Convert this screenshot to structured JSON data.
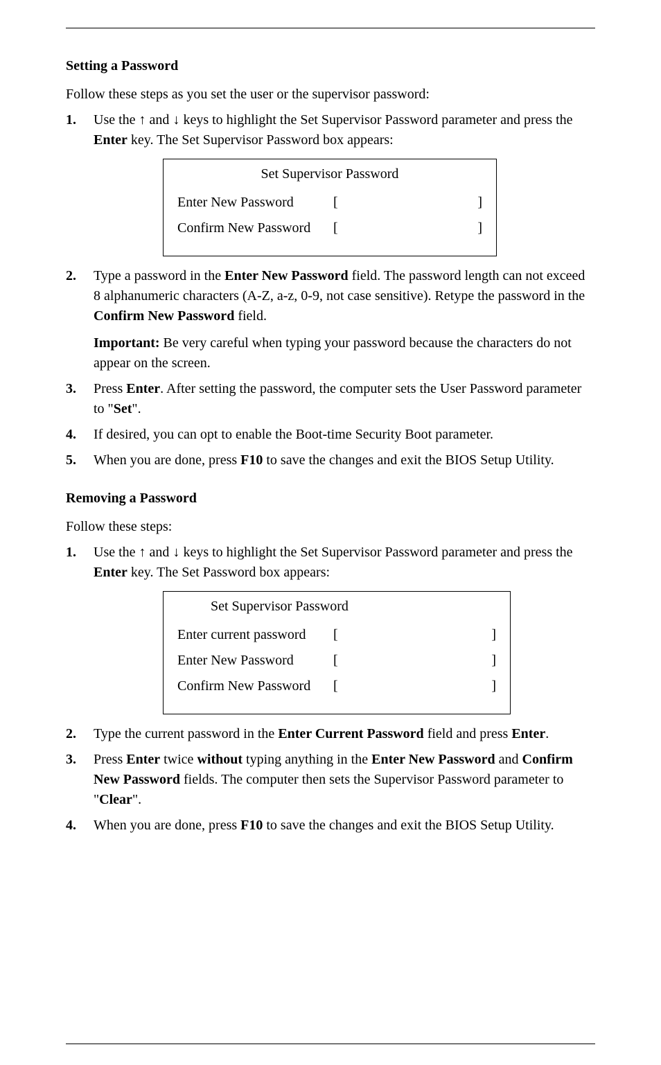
{
  "arrows": {
    "up": "↑",
    "down": "↓"
  },
  "sections": {
    "setting": {
      "heading": "Setting a Password",
      "intro": "Follow these steps as you set the user or the supervisor password:",
      "steps": [
        "Use the    and    keys to highlight the Set Supervisor Password parameter and press the Enter key. The Set Supervisor Password box appears:",
        "Type a password in the Enter New Password field. The password length can not exceed 8 alphanumeric characters (A-Z, a-z, 0-9, not case sensitive). Retype the password in the Confirm New Password field.",
        "Press Enter. After setting the password, the computer sets the User Password parameter to \"Set\"."
      ],
      "important": "Be very careful when typing your password because the characters do not appear on the screen.",
      "tail": [
        "If desired, you can opt to enable the Boot-time Security Boot parameter.",
        "When you are done, press F10 to save the changes and exit the BIOS Setup Utility."
      ],
      "important_label": "Important:"
    },
    "removing": {
      "heading": "Removing a Password",
      "intro": "Follow these steps:",
      "steps": [
        "Use the    and    keys to highlight the Set Supervisor Password parameter and press the Enter key. The Set Password box appears:",
        "Type the current password in the Enter Current Password field and press Enter.",
        "Press Enter twice without typing anything in the Enter New Password and Confirm New Password fields. The computer then sets the Supervisor Password parameter to \"Clear\".",
        "When you are done, press F10 to save the changes and exit the BIOS Setup Utility."
      ]
    }
  },
  "dialog1": {
    "title": "Set Supervisor Password",
    "rows": [
      {
        "label": "Enter New Password"
      },
      {
        "label": "Confirm New Password"
      }
    ]
  },
  "dialog2": {
    "title": "Set Supervisor Password",
    "rows": [
      {
        "label": "Enter current password"
      },
      {
        "label": "Enter New Password"
      },
      {
        "label": "Confirm New Password"
      }
    ]
  },
  "brackets": {
    "open": "[",
    "close": "]"
  },
  "footer": {
    "left": "",
    "right": ""
  }
}
